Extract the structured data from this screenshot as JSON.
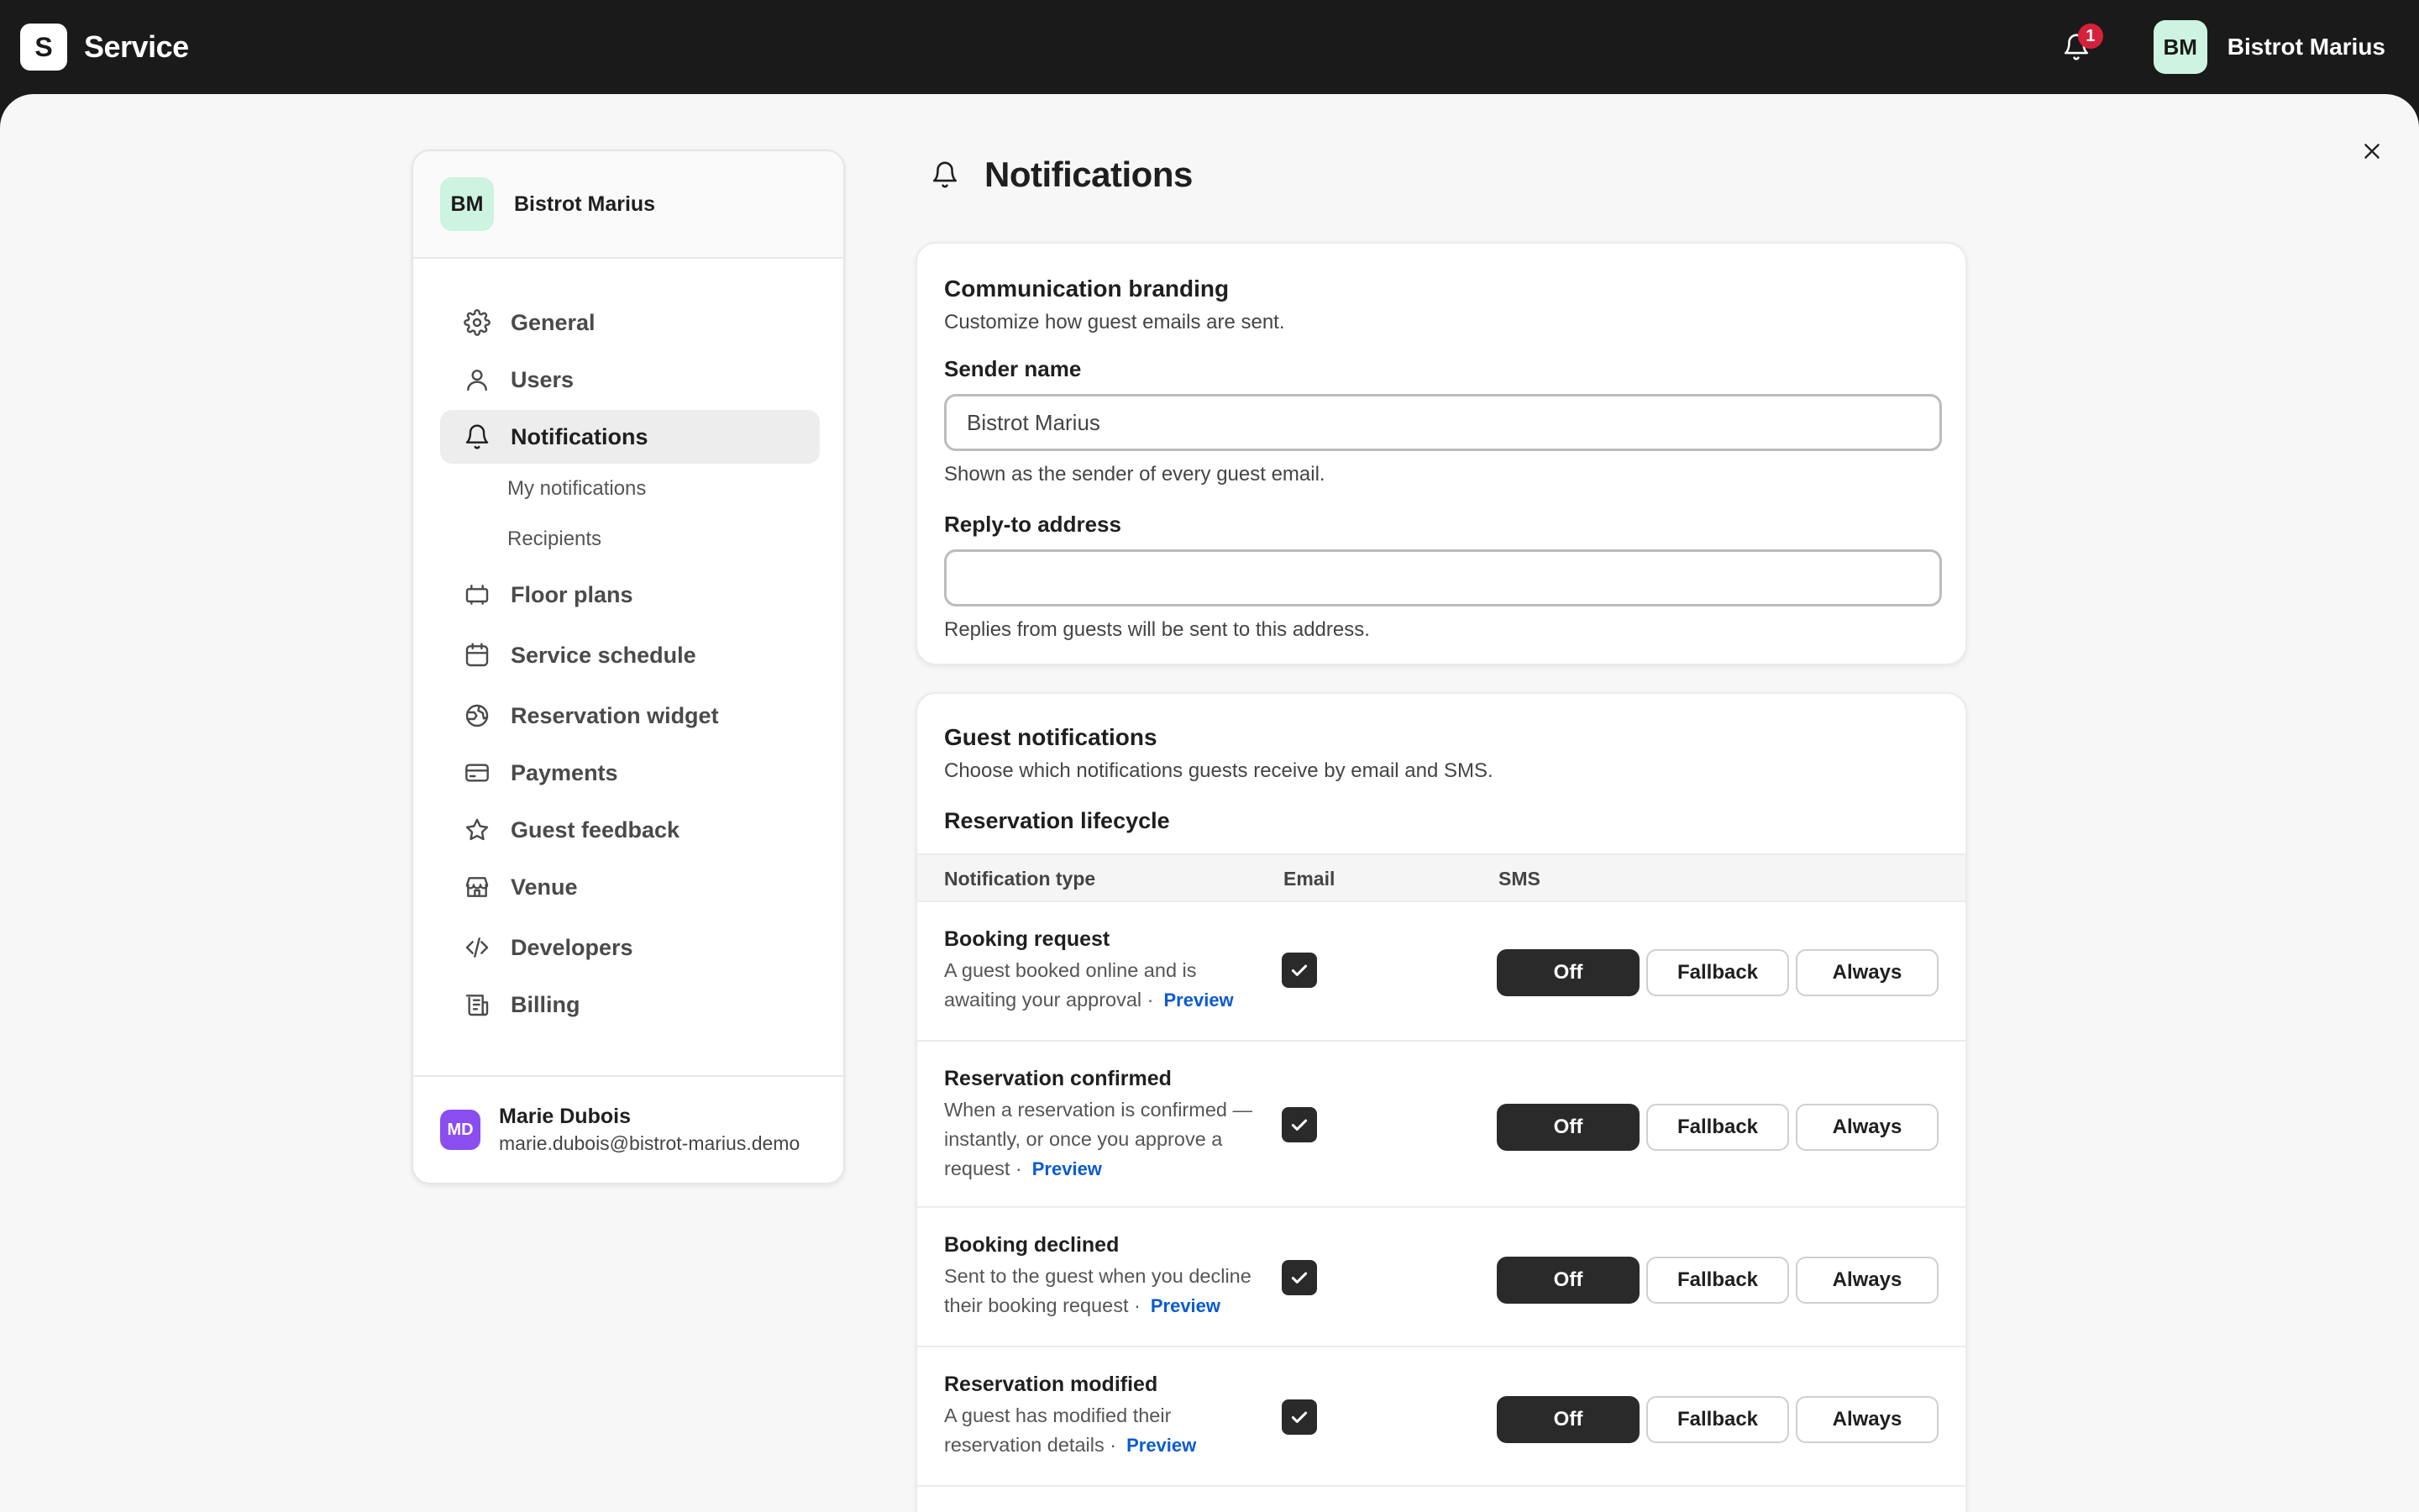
{
  "topbar": {
    "logo_letter": "S",
    "app_name": "Service",
    "notification_count": "1",
    "user_initials": "BM",
    "user_name": "Bistrot Marius"
  },
  "sidebar": {
    "venue_initials": "BM",
    "venue_name": "Bistrot Marius",
    "items": [
      {
        "label": "General",
        "icon": "gear-icon"
      },
      {
        "label": "Users",
        "icon": "user-icon"
      },
      {
        "label": "Notifications",
        "icon": "bell-icon",
        "active": true
      },
      {
        "label": "Floor plans",
        "icon": "floor-plan-icon"
      },
      {
        "label": "Service schedule",
        "icon": "calendar-icon"
      },
      {
        "label": "Reservation widget",
        "icon": "globe-icon"
      },
      {
        "label": "Payments",
        "icon": "credit-card-icon"
      },
      {
        "label": "Guest feedback",
        "icon": "star-icon"
      },
      {
        "label": "Venue",
        "icon": "store-icon"
      },
      {
        "label": "Developers",
        "icon": "code-icon"
      },
      {
        "label": "Billing",
        "icon": "receipt-icon"
      }
    ],
    "sub_items": [
      "My notifications",
      "Recipients"
    ],
    "footer": {
      "initials": "MD",
      "name": "Marie Dubois",
      "email": "marie.dubois@bistrot-marius.demo"
    }
  },
  "page": {
    "title": "Notifications"
  },
  "branding": {
    "title": "Communication branding",
    "subtitle": "Customize how guest emails are sent.",
    "sender_label": "Sender name",
    "sender_value": "Bistrot Marius",
    "sender_help": "Shown as the sender of every guest email.",
    "reply_label": "Reply-to address",
    "reply_value": "",
    "reply_help": "Replies from guests will be sent to this address."
  },
  "guest": {
    "title": "Guest notifications",
    "subtitle": "Choose which notifications guests receive by email and SMS.",
    "section": "Reservation lifecycle",
    "columns": {
      "type": "Notification type",
      "email": "Email",
      "sms": "SMS"
    },
    "sms_options": [
      "Off",
      "Fallback",
      "Always"
    ],
    "preview_label": "Preview",
    "rows": [
      {
        "title": "Booking request",
        "desc": "A guest booked online and is awaiting your approval ·",
        "email": true,
        "sms": "Off"
      },
      {
        "title": "Reservation confirmed",
        "desc": "When a reservation is confirmed — instantly, or once you approve a request ·",
        "email": true,
        "sms": "Off"
      },
      {
        "title": "Booking declined",
        "desc": "Sent to the guest when you decline their booking request ·",
        "email": true,
        "sms": "Off"
      },
      {
        "title": "Reservation modified",
        "desc": "A guest has modified their reservation details ·",
        "email": true,
        "sms": "Off"
      }
    ]
  },
  "colors": {
    "topbar": "#1a1a1a",
    "accent_avatar": "#cdf3e1",
    "badge": "#d6213a",
    "link": "#0a5bd0",
    "user_avatar": "#8a4df0"
  }
}
